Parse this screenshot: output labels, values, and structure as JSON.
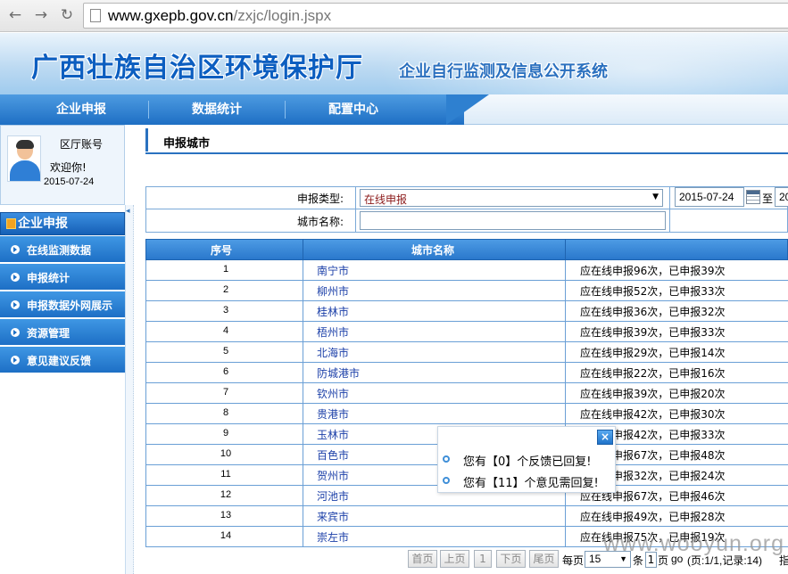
{
  "browser": {
    "url_host": "www.gxepb.gov.cn",
    "url_path": "/zxjc/login.jspx"
  },
  "header": {
    "title": "广西壮族自治区环境保护厅",
    "subtitle": "企业自行监测及信息公开系统"
  },
  "nav": {
    "items": [
      {
        "label": "企业申报"
      },
      {
        "label": "数据统计"
      },
      {
        "label": "配置中心"
      }
    ]
  },
  "user": {
    "account": "区厅账号",
    "welcome": "欢迎你!",
    "date": "2015-07-24"
  },
  "sidebar": {
    "heading": "企业申报",
    "items": [
      {
        "label": "在线监测数据"
      },
      {
        "label": "申报统计"
      },
      {
        "label": "申报数据外网展示"
      },
      {
        "label": "资源管理"
      },
      {
        "label": "意见建议反馈"
      }
    ]
  },
  "content": {
    "title": "申报城市"
  },
  "form": {
    "type_label": "申报类型:",
    "type_value": "在线申报",
    "city_label": "城市名称:",
    "date_from": "2015-07-24",
    "date_to_label": "至",
    "date_to": "20"
  },
  "table": {
    "headers": [
      "序号",
      "城市名称"
    ],
    "rows": [
      {
        "idx": "1",
        "city": "南宁市",
        "stat": "应在线申报96次，已申报39次"
      },
      {
        "idx": "2",
        "city": "柳州市",
        "stat": "应在线申报52次，已申报33次"
      },
      {
        "idx": "3",
        "city": "桂林市",
        "stat": "应在线申报36次，已申报32次"
      },
      {
        "idx": "4",
        "city": "梧州市",
        "stat": "应在线申报39次，已申报33次"
      },
      {
        "idx": "5",
        "city": "北海市",
        "stat": "应在线申报29次，已申报14次"
      },
      {
        "idx": "6",
        "city": "防城港市",
        "stat": "应在线申报22次，已申报16次"
      },
      {
        "idx": "7",
        "city": "钦州市",
        "stat": "应在线申报39次，已申报20次"
      },
      {
        "idx": "8",
        "city": "贵港市",
        "stat": "应在线申报42次，已申报30次"
      },
      {
        "idx": "9",
        "city": "玉林市",
        "stat": "应在线申报42次，已申报33次"
      },
      {
        "idx": "10",
        "city": "百色市",
        "stat": "应在线申报67次，已申报48次"
      },
      {
        "idx": "11",
        "city": "贺州市",
        "stat": "应在线申报32次，已申报24次"
      },
      {
        "idx": "12",
        "city": "河池市",
        "stat": "应在线申报67次，已申报46次"
      },
      {
        "idx": "13",
        "city": "来宾市",
        "stat": "应在线申报49次，已申报28次"
      },
      {
        "idx": "14",
        "city": "崇左市",
        "stat": "应在线申报75次，已申报19次"
      }
    ]
  },
  "pager": {
    "first": "首页",
    "prev": "上页",
    "current": "1",
    "next": "下页",
    "last": "尾页",
    "per_page_label": "每页",
    "per_page": "15",
    "unit": "条",
    "page_input": "1",
    "page_label": "页",
    "go": "go",
    "summary": "(页:1/1,记录:14)",
    "tail": "指"
  },
  "popup": {
    "items": [
      {
        "text": "您有【0】个反馈已回复!"
      },
      {
        "text": "您有【11】个意见需回复!"
      }
    ]
  },
  "watermark": "www.wooyun.org"
}
